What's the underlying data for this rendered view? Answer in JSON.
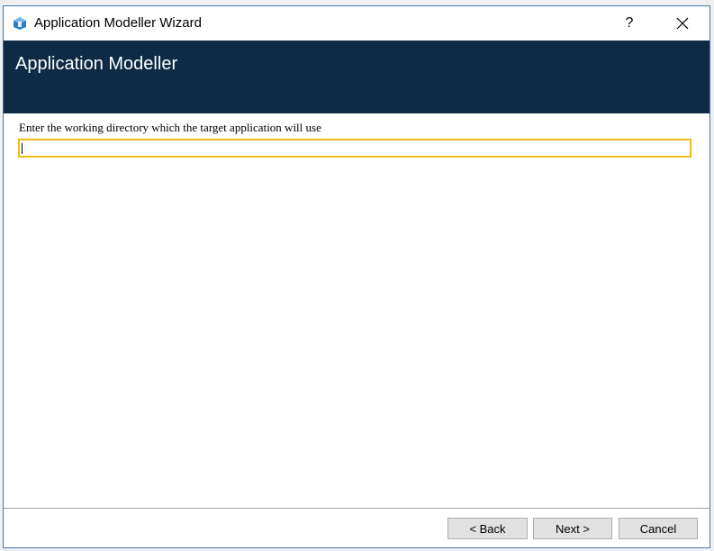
{
  "window": {
    "title": "Application Modeller Wizard",
    "help_label": "?",
    "icon": "app-modeller-icon",
    "close_icon": "close-icon"
  },
  "header": {
    "title": "Application Modeller"
  },
  "form": {
    "prompt": "Enter the working directory which the target application will use",
    "directory_value": "",
    "focus_color": "#f0bb1a"
  },
  "footer": {
    "back_label": "< Back",
    "next_label": "Next >",
    "cancel_label": "Cancel"
  },
  "colors": {
    "header_bg": "#0e2a47",
    "header_text": "#ffffff"
  }
}
